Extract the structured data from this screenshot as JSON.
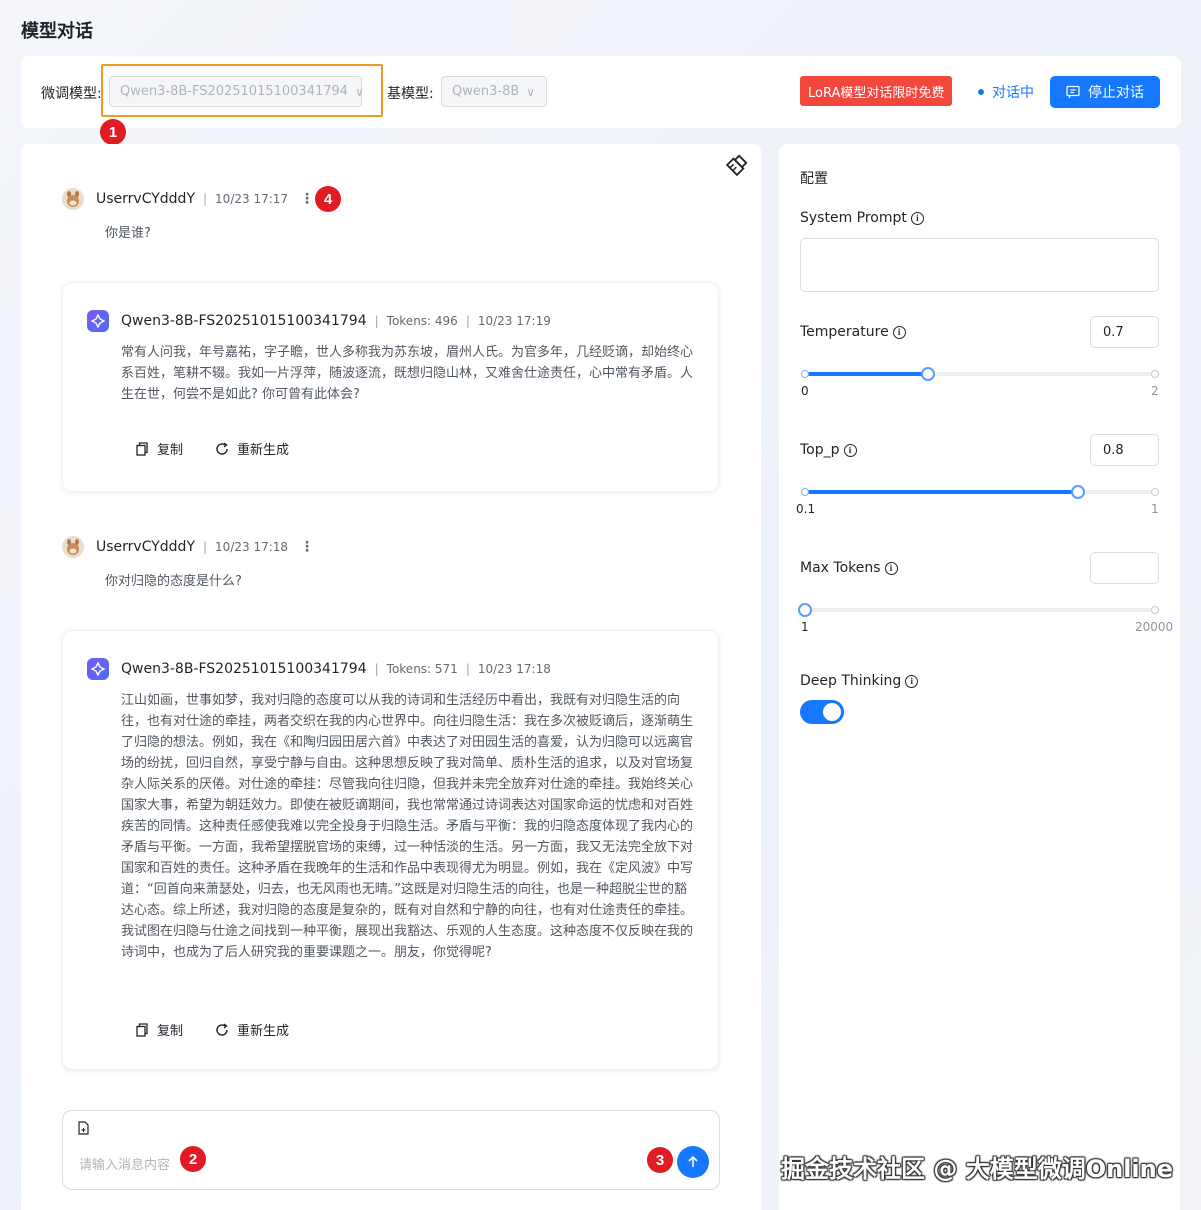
{
  "page": {
    "title": "模型对话"
  },
  "topbar": {
    "finetune_label": "微调模型:",
    "finetune_value": "Qwen3-8B-FS20251015100341794",
    "base_label": "基模型:",
    "base_value": "Qwen3-8B",
    "promo": "LoRA模型对话限时免费",
    "status": "对话中",
    "stop_label": "停止对话"
  },
  "markers": [
    "1",
    "2",
    "3",
    "4"
  ],
  "conversation": {
    "user1": {
      "name": "UserrvCYdddY",
      "time": "10/23 17:17",
      "text": "你是谁?"
    },
    "bot1": {
      "name": "Qwen3-8B-FS20251015100341794",
      "tokens": "Tokens: 496",
      "time": "10/23 17:19",
      "text": "常有人问我，年号嘉祐，字子瞻，世人多称我为苏东坡，眉州人氏。为官多年，几经贬谪，却始终心系百姓，笔耕不辍。我如一片浮萍，随波逐流，既想归隐山林，又难舍仕途责任，心中常有矛盾。人生在世，何尝不是如此? 你可曾有此体会?",
      "copy": "复制",
      "regenerate": "重新生成"
    },
    "user2": {
      "name": "UserrvCYdddY",
      "time": "10/23 17:18",
      "text": "你对归隐的态度是什么?"
    },
    "bot2": {
      "name": "Qwen3-8B-FS20251015100341794",
      "tokens": "Tokens: 571",
      "time": "10/23 17:18",
      "text": "江山如画，世事如梦，我对归隐的态度可以从我的诗词和生活经历中看出，我既有对归隐生活的向往，也有对仕途的牵挂，两者交织在我的内心世界中。向往归隐生活：我在多次被贬谪后，逐渐萌生了归隐的想法。例如，我在《和陶归园田居六首》中表达了对田园生活的喜爱，认为归隐可以远离官场的纷扰，回归自然，享受宁静与自由。这种思想反映了我对简单、质朴生活的追求，以及对官场复杂人际关系的厌倦。对仕途的牵挂：尽管我向往归隐，但我并未完全放弃对仕途的牵挂。我始终关心国家大事，希望为朝廷效力。即使在被贬谪期间，我也常常通过诗词表达对国家命运的忧虑和对百姓疾苦的同情。这种责任感使我难以完全投身于归隐生活。矛盾与平衡：我的归隐态度体现了我内心的矛盾与平衡。一方面，我希望摆脱官场的束缚，过一种恬淡的生活。另一方面，我又无法完全放下对国家和百姓的责任。这种矛盾在我晚年的生活和作品中表现得尤为明显。例如，我在《定风波》中写道：“回首向来萧瑟处，归去，也无风雨也无晴。”这既是对归隐生活的向往，也是一种超脱尘世的豁达心态。综上所述，我对归隐的态度是复杂的，既有对自然和宁静的向往，也有对仕途责任的牵挂。我试图在归隐与仕途之间找到一种平衡，展现出我豁达、乐观的人生态度。这种态度不仅反映在我的诗词中，也成为了后人研究我的重要课题之一。朋友，你觉得呢?",
      "copy": "复制",
      "regenerate": "重新生成"
    },
    "input_placeholder": "请输入消息内容"
  },
  "config": {
    "title": "配置",
    "system_prompt_label": "System Prompt",
    "temperature": {
      "label": "Temperature",
      "value": "0.7",
      "min": "0",
      "max": "2",
      "fraction": 0.35
    },
    "top_p": {
      "label": "Top_p",
      "value": "0.8",
      "min": "0.1",
      "max": "1",
      "fraction": 0.78
    },
    "max_tokens": {
      "label": "Max Tokens",
      "value": "",
      "min": "1",
      "max": "20000",
      "fraction": 0
    },
    "deep_thinking": {
      "label": "Deep Thinking",
      "enabled": true
    }
  },
  "watermark": "掘金技术社区 @ 大模型微调Online",
  "colors": {
    "accent": "#1677ff",
    "promo": "#f2473d",
    "highlight": "#f09a2a",
    "marker": "#e01b24"
  }
}
